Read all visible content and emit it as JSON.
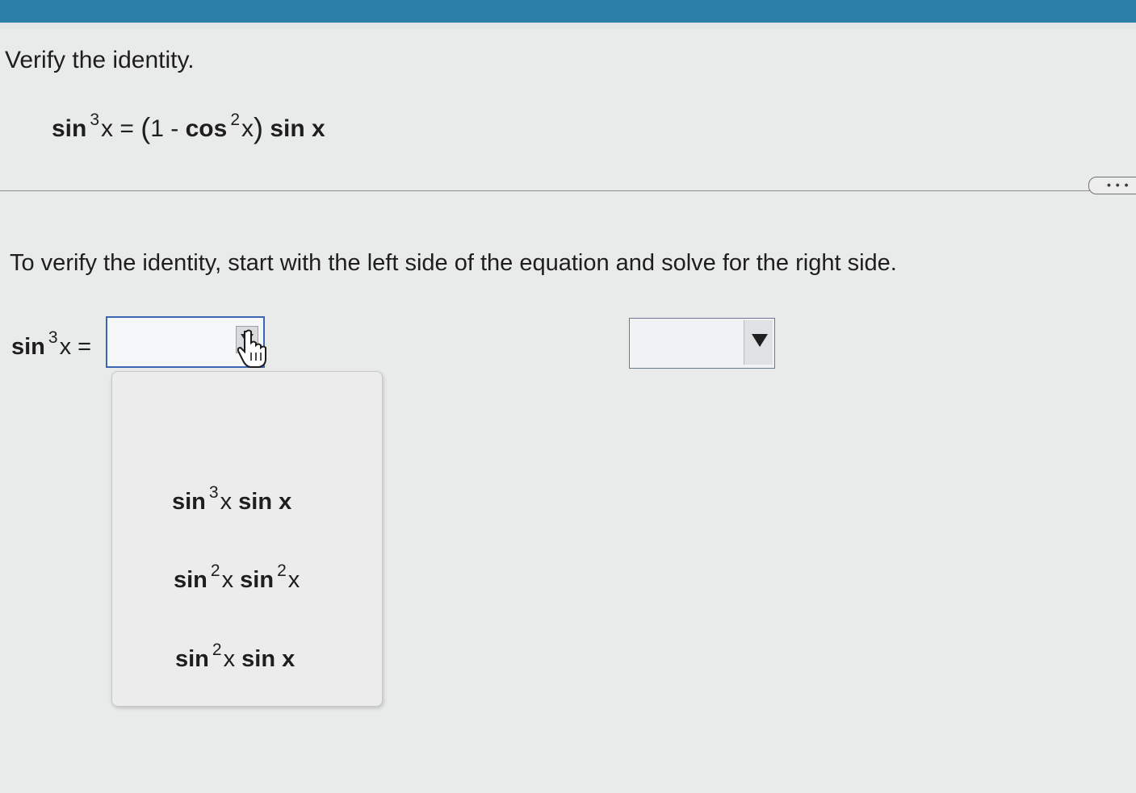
{
  "header": {
    "bar_color": "#2c7fa8"
  },
  "question": {
    "title": "Verify the identity.",
    "identity": {
      "lhs_func": "sin",
      "lhs_exp": "3",
      "lhs_var": "x",
      "equals": "=",
      "open_paren": "(",
      "one_minus": "1 -",
      "cos_func": "cos",
      "cos_exp": "2",
      "cos_var": "x",
      "close_paren": ")",
      "rhs_tail": "sin x"
    }
  },
  "more_button": {
    "label": "• • •"
  },
  "step": {
    "instruction": "To verify the identity, start with the left side of the equation and solve for the right side.",
    "lhs_func": "sin",
    "lhs_exp": "3",
    "lhs_var": "x",
    "equals": "=",
    "select1_value": "",
    "select2_value": ""
  },
  "dropdown": {
    "options": [
      {
        "func1": "sin",
        "exp1": "3",
        "var1": "x",
        "tail": "sin x",
        "exp2": ""
      },
      {
        "func1": "sin",
        "exp1": "2",
        "var1": "x",
        "tail": "sin",
        "exp2": "2",
        "var2": "x"
      },
      {
        "func1": "sin",
        "exp1": "2",
        "var1": "x",
        "tail": "sin x",
        "exp2": ""
      }
    ]
  },
  "icons": {
    "dropdown_arrow": "triangle-down-icon",
    "cursor": "hand-pointer-icon"
  },
  "colors": {
    "focus_border": "#3d65b5",
    "background": "#e9eaea"
  }
}
